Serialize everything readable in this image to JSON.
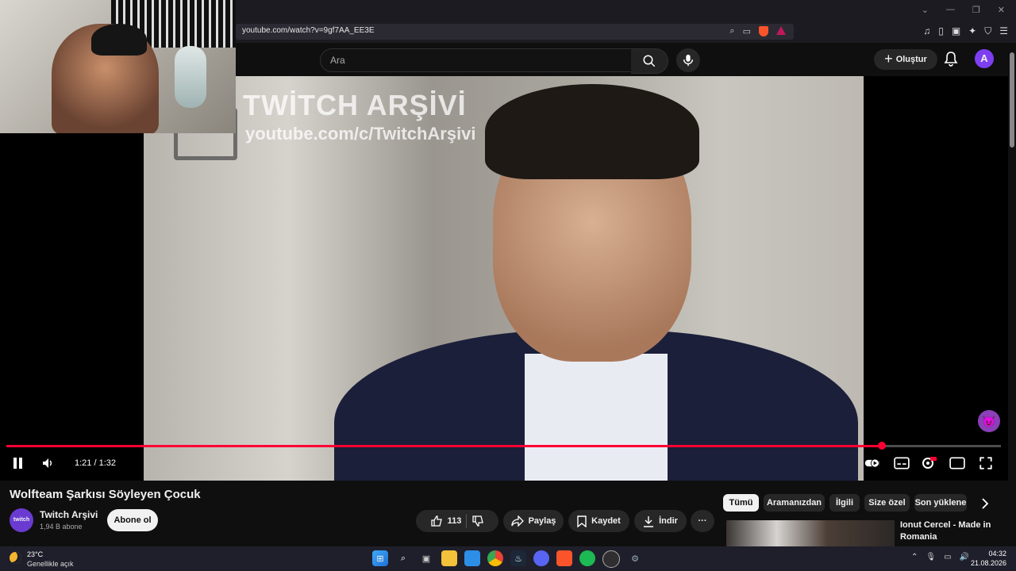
{
  "browser": {
    "url": "youtube.com/watch?v=9gf7AA_EE3E",
    "window_controls": [
      "⌄",
      "—",
      "❐",
      "✕"
    ]
  },
  "header": {
    "search_placeholder": "Ara",
    "create_label": "Oluştur",
    "avatar_letter": "A"
  },
  "video": {
    "watermark_title": "TWİTCH ARŞİVİ",
    "watermark_url": "youtube.com/c/TwitchArşivi",
    "time_display": "1:21 / 1:32",
    "progress_fraction": 0.88
  },
  "details": {
    "title": "Wolfteam Şarkısı Söyleyen Çocuk",
    "channel_avatar_text": "twitch",
    "channel_name": "Twitch Arşivi",
    "subscribers": "1,94 B abone",
    "subscribe_label": "Abone ol",
    "like_count": "113",
    "share_label": "Paylaş",
    "save_label": "Kaydet",
    "download_label": "İndir",
    "more_label": "···"
  },
  "chips": [
    "Tümü",
    "Aramanızdan",
    "İlgili",
    "Size özel",
    "Son yüklene"
  ],
  "recommendation": {
    "title": "Ionut Cercel - Made in Romania"
  },
  "taskbar": {
    "temperature": "23°C",
    "weather_desc": "Genellikle açık",
    "time": "04:32",
    "date": "21.08.2026"
  },
  "colors": {
    "accent": "#ff0033",
    "avatar": "#7e3ff2",
    "background": "#0f0f0f"
  }
}
